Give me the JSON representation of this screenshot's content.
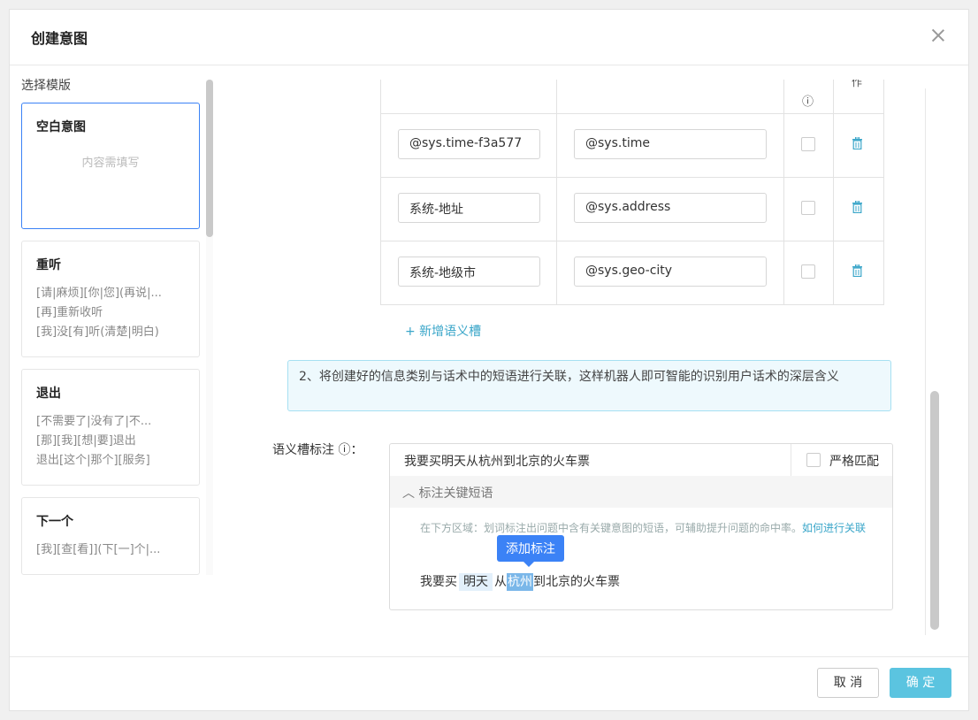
{
  "dialog": {
    "title": "创建意图"
  },
  "templates": {
    "label": "选择模版",
    "items": [
      {
        "title": "空白意图",
        "placeholder": "内容需填写",
        "lines": []
      },
      {
        "title": "重听",
        "lines": [
          "[请|麻烦][你|您](再说|...",
          "[再]重新收听",
          "[我]没[有]听(清楚|明白)"
        ]
      },
      {
        "title": "退出",
        "lines": [
          "[不需要了|没有了|不...",
          "[那][我][想|要]退出",
          "退出[这个|那个][服务]"
        ]
      },
      {
        "title": "下一个",
        "lines": [
          "[我][查[看]](下[一]个|..."
        ]
      }
    ]
  },
  "slots": {
    "header": {
      "required_icon": "ⓘ",
      "op_label": "作"
    },
    "rows": [
      {
        "name": "@sys.time-f3a577",
        "entity": "@sys.time"
      },
      {
        "name": "系统-地址",
        "entity": "@sys.address"
      },
      {
        "name": "系统-地级市",
        "entity": "@sys.geo-city"
      }
    ],
    "add_label": "+ 新增语义槽"
  },
  "notice": "2、将创建好的信息类别与话术中的短语进行关联，这样机器人即可智能的识别用户话术的深层含义",
  "annotation": {
    "label": "语义槽标注 ⓘ：",
    "input_text": "我要买明天从杭州到北京的火车票",
    "strict_label": "严格匹配",
    "collapse_label": "标注关键短语",
    "hint_text": "在下方区域：划词标注出问题中含有关键意图的短语，可辅助提升问题的命中率。",
    "hint_link": "如何进行关联",
    "sentence": {
      "part1": "我要买",
      "tag1": "明天",
      "part2": "从",
      "sel": "杭州",
      "part3": "到北京的火车票"
    },
    "tooltip": "添加标注"
  },
  "footer": {
    "cancel": "取 消",
    "ok": "确 定"
  }
}
